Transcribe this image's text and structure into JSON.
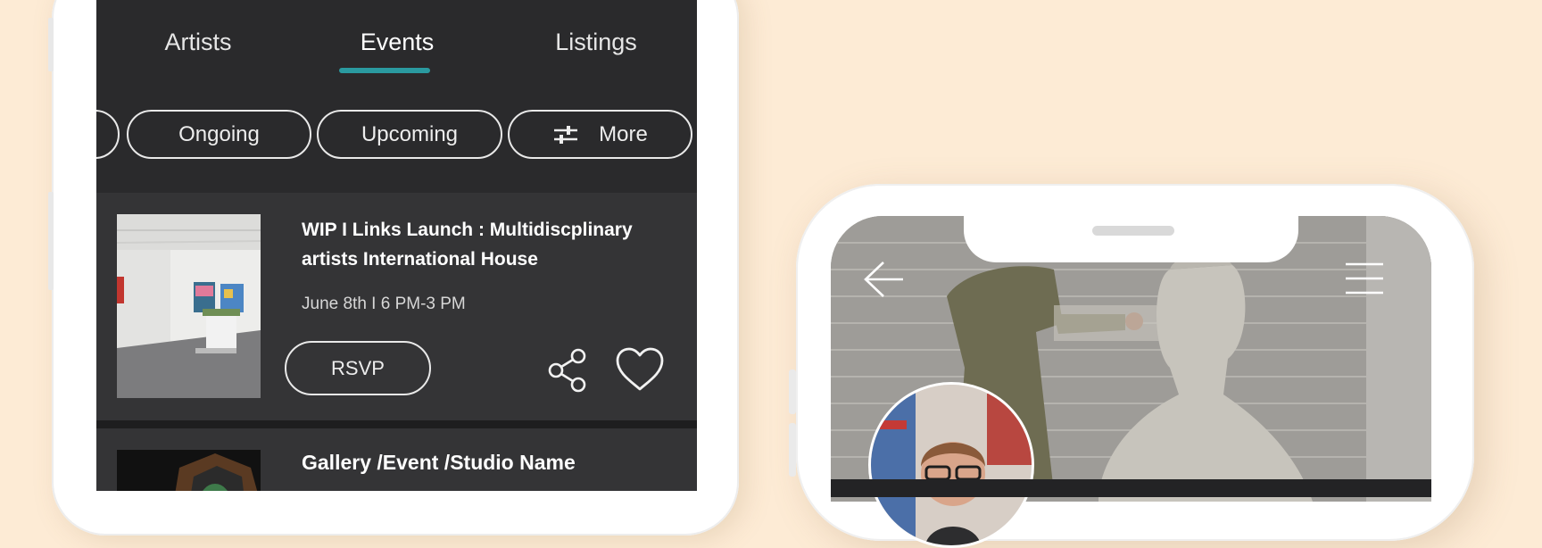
{
  "tabs": [
    {
      "label": "Artists"
    },
    {
      "label": "Events"
    },
    {
      "label": "Listings"
    }
  ],
  "active_tab": "Events",
  "filters": [
    {
      "label": "Ongoing"
    },
    {
      "label": "Upcoming"
    },
    {
      "label": "More"
    }
  ],
  "events": [
    {
      "title": "WIP I Links Launch : Multidiscplinary artists International House",
      "date": "June 8th I 6 PM-3 PM",
      "rsvp_label": "RSVP"
    },
    {
      "title": "Gallery /Event /Studio Name"
    }
  ],
  "colors": {
    "background": "#FDEBD5",
    "screen": "#2A2A2C",
    "card": "#343436",
    "accent": "#2A9AA0",
    "text": "#FFFFFF"
  },
  "icons": {
    "filter": "sliders-icon",
    "share": "share-icon",
    "favorite": "heart-icon",
    "back": "arrow-left-icon",
    "menu": "hamburger-menu-icon"
  }
}
